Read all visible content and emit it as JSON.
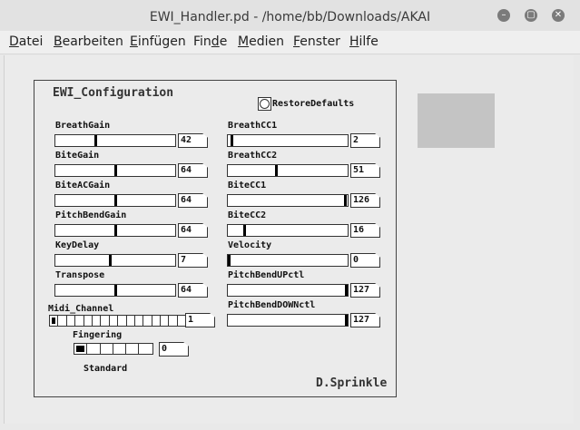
{
  "window": {
    "title": "EWI_Handler.pd - /home/bb/Downloads/AKAI",
    "buttons": {
      "minimize": "–",
      "maximize": "▢",
      "close": "✕"
    }
  },
  "menu": [
    {
      "pre": "",
      "ul": "D",
      "post": "atei"
    },
    {
      "pre": "",
      "ul": "B",
      "post": "earbeiten"
    },
    {
      "pre": "",
      "ul": "E",
      "post": "infügen"
    },
    {
      "pre": "Fin",
      "ul": "d",
      "post": "e"
    },
    {
      "pre": "",
      "ul": "M",
      "post": "edien"
    },
    {
      "pre": "",
      "ul": "F",
      "post": "enster"
    },
    {
      "pre": "",
      "ul": "H",
      "post": "ilfe"
    }
  ],
  "panel": {
    "title": "EWI_Configuration",
    "author": "D.Sprinkle",
    "restore_label": "RestoreDefaults",
    "left_params": [
      {
        "label": "BreathGain",
        "value": "42",
        "level": 0.33
      },
      {
        "label": "BiteGain",
        "value": "64",
        "level": 0.5
      },
      {
        "label": "BiteACGain",
        "value": "64",
        "level": 0.5
      },
      {
        "label": "PitchBendGain",
        "value": "64",
        "level": 0.5
      },
      {
        "label": "KeyDelay",
        "value": "7",
        "level": 0.46
      },
      {
        "label": "Transpose",
        "value": "64",
        "level": 0.5
      }
    ],
    "right_params": [
      {
        "label": "BreathCC1",
        "value": "2",
        "level": 0.02
      },
      {
        "label": "BreathCC2",
        "value": "51",
        "level": 0.4
      },
      {
        "label": "BiteCC1",
        "value": "126",
        "level": 0.99
      },
      {
        "label": "BiteCC2",
        "value": "16",
        "level": 0.13
      },
      {
        "label": "Velocity",
        "value": "0",
        "level": 0.0
      },
      {
        "label": "PitchBendUPctl",
        "value": "127",
        "level": 1.0
      },
      {
        "label": "PitchBendDOWNctl",
        "value": "127",
        "level": 1.0
      }
    ],
    "midi_channel": {
      "label": "Midi_Channel",
      "value": "1",
      "cells": 16,
      "selected": 0
    },
    "fingering": {
      "label": "Fingering",
      "value": "0",
      "cells": 6,
      "selected": 0,
      "mode": "Standard"
    }
  }
}
